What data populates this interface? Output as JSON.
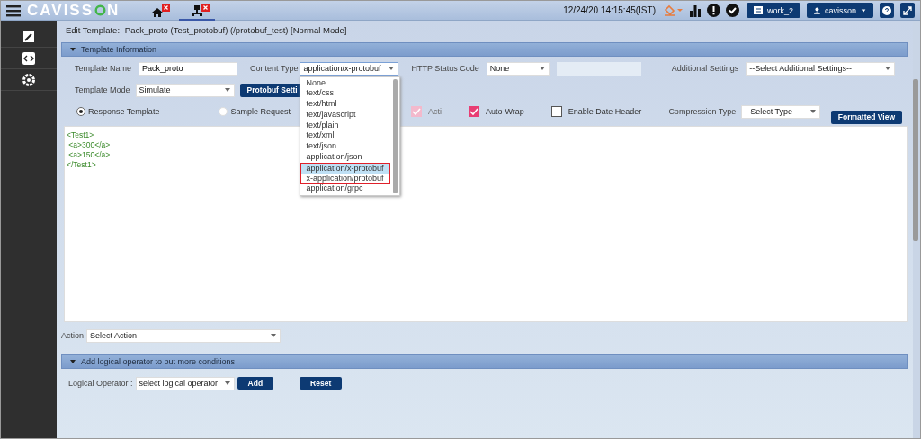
{
  "header": {
    "logo": "CAVISS",
    "logo_tail": "N",
    "tabs": [
      {
        "kind": "home",
        "selected": false
      },
      {
        "kind": "network",
        "selected": true
      }
    ],
    "datetime": "12/24/20 14:15:45(IST)",
    "workspace": "work_2",
    "user": "cavisson"
  },
  "sidebar": {
    "items": [
      {
        "kind": "edit"
      },
      {
        "kind": "code"
      },
      {
        "kind": "gear"
      }
    ]
  },
  "page_title": "Edit Template:- Pack_proto (Test_protobuf) (/protobuf_test) [Normal Mode]",
  "template_info": {
    "title": "Template Information",
    "expanded": true,
    "template_name": {
      "label": "Template Name",
      "value": "Pack_proto"
    },
    "content_type": {
      "label": "Content Type",
      "value": "application/x-protobuf"
    },
    "http_status": {
      "label": "HTTP Status Code",
      "value": "None"
    },
    "additional": {
      "label": "Additional Settings",
      "value": "--Select Additional Settings--"
    },
    "template_mode": {
      "label": "Template Mode",
      "value": "Simulate"
    },
    "protobuf_button": "Protobuf Setti",
    "radios": [
      {
        "label": "Response Template",
        "selected": true
      },
      {
        "label": "Sample Request",
        "selected": false
      }
    ],
    "checks": [
      {
        "label": "Acti",
        "checked": true,
        "disabled": true
      },
      {
        "label": "Auto-Wrap",
        "checked": true,
        "disabled": false
      },
      {
        "label": "Enable Date Header",
        "checked": false,
        "disabled": false
      }
    ],
    "compression": {
      "label": "Compression Type",
      "value": "--Select Type--"
    },
    "formatted_view": "Formatted View",
    "editor_lines": [
      "<Test1>",
      " <a>300</a>",
      " <a>150</a>",
      "</Test1>"
    ],
    "content_type_options": [
      {
        "label": "None",
        "selected": false,
        "highlighted": false
      },
      {
        "label": "text/css",
        "selected": false,
        "highlighted": false
      },
      {
        "label": "text/html",
        "selected": false,
        "highlighted": false
      },
      {
        "label": "text/javascript",
        "selected": false,
        "highlighted": false
      },
      {
        "label": "text/plain",
        "selected": false,
        "highlighted": false
      },
      {
        "label": "text/xml",
        "selected": false,
        "highlighted": false
      },
      {
        "label": "text/json",
        "selected": false,
        "highlighted": false
      },
      {
        "label": "application/json",
        "selected": false,
        "highlighted": false
      },
      {
        "label": "application/x-protobuf",
        "selected": true,
        "highlighted": true
      },
      {
        "label": "x-application/protobuf",
        "selected": false,
        "highlighted": true
      },
      {
        "label": "application/grpc",
        "selected": false,
        "highlighted": false
      }
    ]
  },
  "action": {
    "label": "Action",
    "value": "Select Action"
  },
  "logical": {
    "title": "Add logical operator to put more conditions",
    "expanded": true,
    "label": "Logical Operator :",
    "value": "select logical operator",
    "buttons": [
      "Add",
      "Reset"
    ]
  }
}
